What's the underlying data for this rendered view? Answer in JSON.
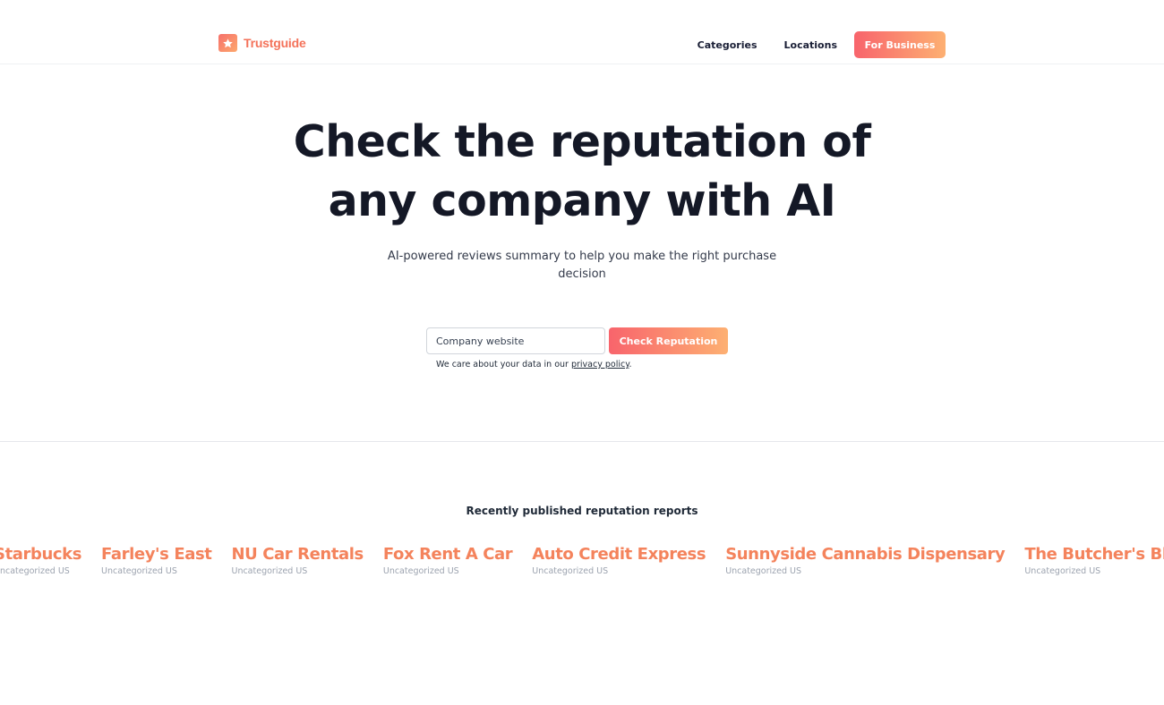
{
  "header": {
    "logo_text": "Trustguide",
    "logo_icon": "star-icon",
    "nav": {
      "categories": "Categories",
      "locations": "Locations",
      "for_business": "For Business"
    }
  },
  "hero": {
    "title_line1": "Check the reputation of",
    "title_line2": "any company with AI",
    "subtitle": "AI-powered reviews summary to help you make the right purchase decision",
    "search_placeholder": "Company website",
    "check_button": "Check Reputation",
    "privacy_prefix": "We care about your data in our ",
    "privacy_link": "privacy policy",
    "privacy_suffix": "."
  },
  "recent": {
    "title": "Recently published reputation reports",
    "reports": [
      {
        "name": "Starbucks",
        "category": "Uncategorized US"
      },
      {
        "name": "Farley's East",
        "category": "Uncategorized US"
      },
      {
        "name": "NU Car Rentals",
        "category": "Uncategorized US"
      },
      {
        "name": "Fox Rent A Car",
        "category": "Uncategorized US"
      },
      {
        "name": "Auto Credit Express",
        "category": "Uncategorized US"
      },
      {
        "name": "Sunnyside Cannabis Dispensary",
        "category": "Uncategorized US"
      },
      {
        "name": "The Butcher's Block",
        "category": "Uncategorized US"
      }
    ]
  },
  "colors": {
    "brand": "#f4725a",
    "gradient_start": "#f8646c",
    "gradient_end": "#fdb072",
    "report_name": "#f4835c"
  }
}
